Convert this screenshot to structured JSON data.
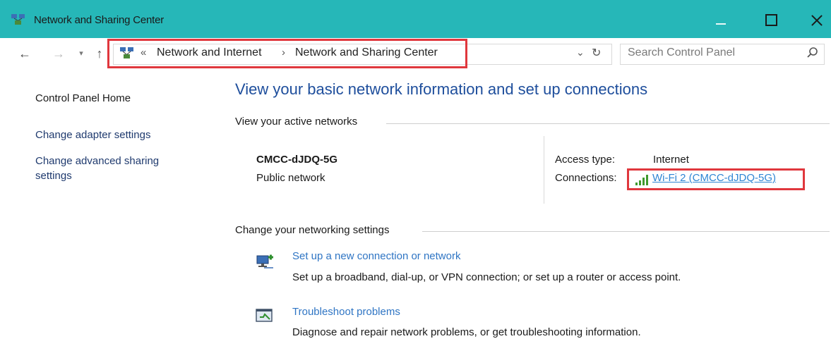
{
  "window": {
    "title": "Network and Sharing Center",
    "accent_color": "#26b7b8"
  },
  "address_bar": {
    "overflow_chevron": "«",
    "breadcrumbs": [
      "Network and Internet",
      "Network and Sharing Center"
    ],
    "separator": "›"
  },
  "search": {
    "placeholder": "Search Control Panel"
  },
  "left_pane": {
    "links": [
      "Control Panel Home",
      "Change adapter settings",
      "Change advanced sharing settings"
    ]
  },
  "main": {
    "title": "View your basic network information and set up connections",
    "active_networks": {
      "heading": "View your active networks",
      "network_name": "CMCC-dJDQ-5G",
      "network_category": "Public network",
      "access_type_label": "Access type:",
      "access_type_value": "Internet",
      "connections_label": "Connections:",
      "connection_link": "Wi-Fi 2 (CMCC-dJDQ-5G)"
    },
    "change_settings": {
      "heading": "Change your networking settings",
      "tasks": [
        {
          "icon": "new-connection-icon",
          "link": "Set up a new connection or network",
          "description": "Set up a broadband, dial-up, or VPN connection; or set up a router or access point."
        },
        {
          "icon": "troubleshoot-icon",
          "link": "Troubleshoot problems",
          "description": "Diagnose and repair network problems, or get troubleshooting information."
        }
      ]
    }
  },
  "highlight_color": "#e0373d",
  "link_color": "#2f86d4"
}
